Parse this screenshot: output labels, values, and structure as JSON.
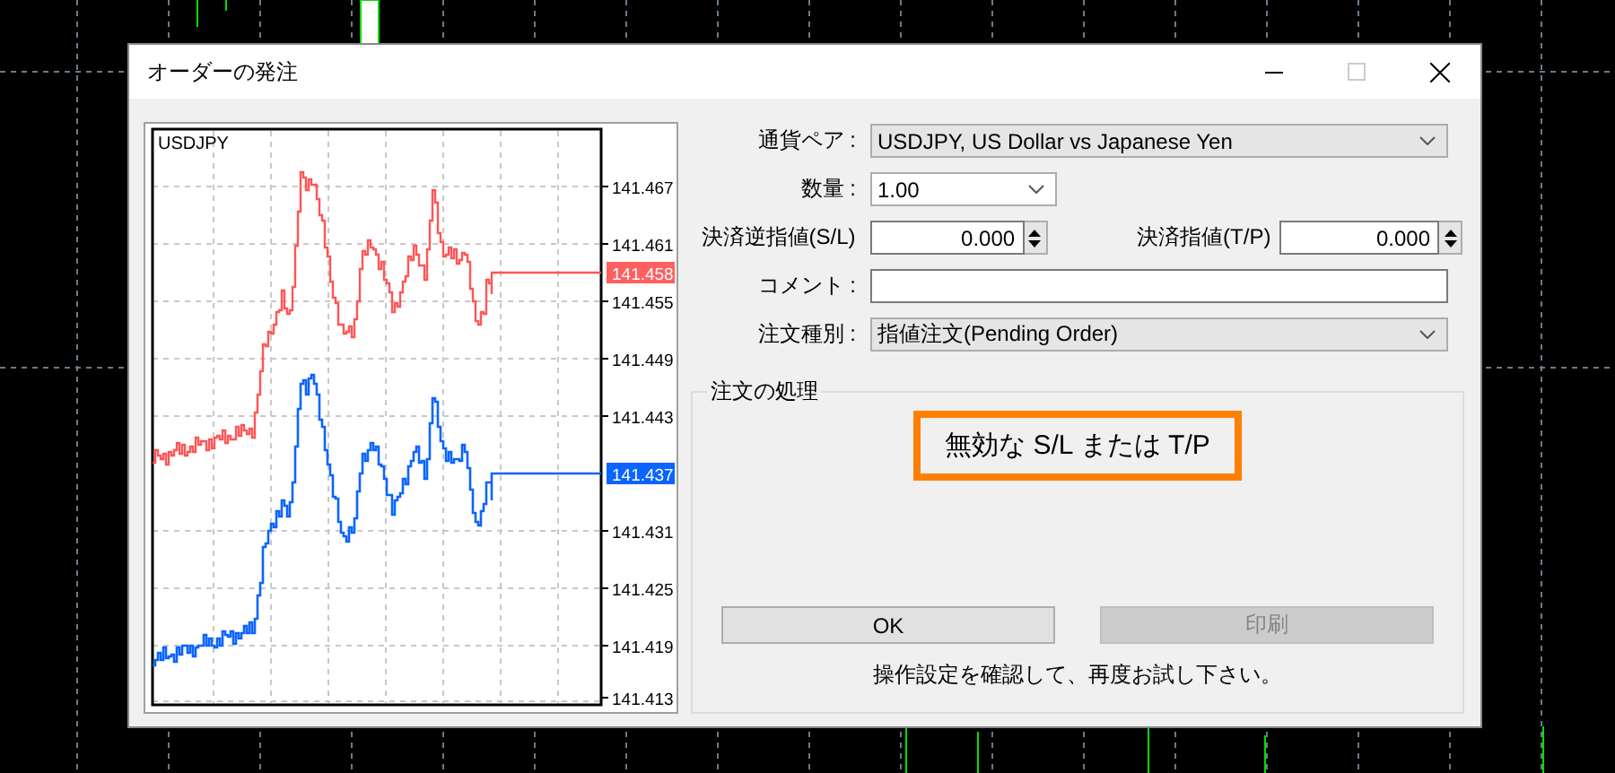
{
  "window": {
    "title": "オーダーの発注"
  },
  "chart": {
    "symbol": "USDJPY",
    "price_ticks": [
      "141.467",
      "141.461",
      "141.455",
      "141.449",
      "141.443",
      "141.431",
      "141.425",
      "141.419",
      "141.413"
    ],
    "ask_price": "141.458",
    "bid_price": "141.437"
  },
  "form": {
    "symbol": {
      "label": "通貨ペア :",
      "value": "USDJPY, US Dollar vs Japanese Yen"
    },
    "volume": {
      "label": "数量 :",
      "value": "1.00"
    },
    "stop_loss": {
      "label": "決済逆指値(S/L)",
      "value": "0.000"
    },
    "take_profit": {
      "label": "決済指値(T/P)",
      "value": "0.000"
    },
    "comment": {
      "label": "コメント :"
    },
    "order_type": {
      "label": "注文種別 :",
      "value": "指値注文(Pending Order)"
    }
  },
  "processing": {
    "title": "注文の処理",
    "message": "無効な S/L または T/P",
    "highlighted": true,
    "buttons": [
      {
        "label": "OK",
        "disabled": false
      },
      {
        "label": "印刷",
        "disabled": true
      }
    ],
    "hint": "操作設定を確認して、再度お試し下さい。"
  }
}
